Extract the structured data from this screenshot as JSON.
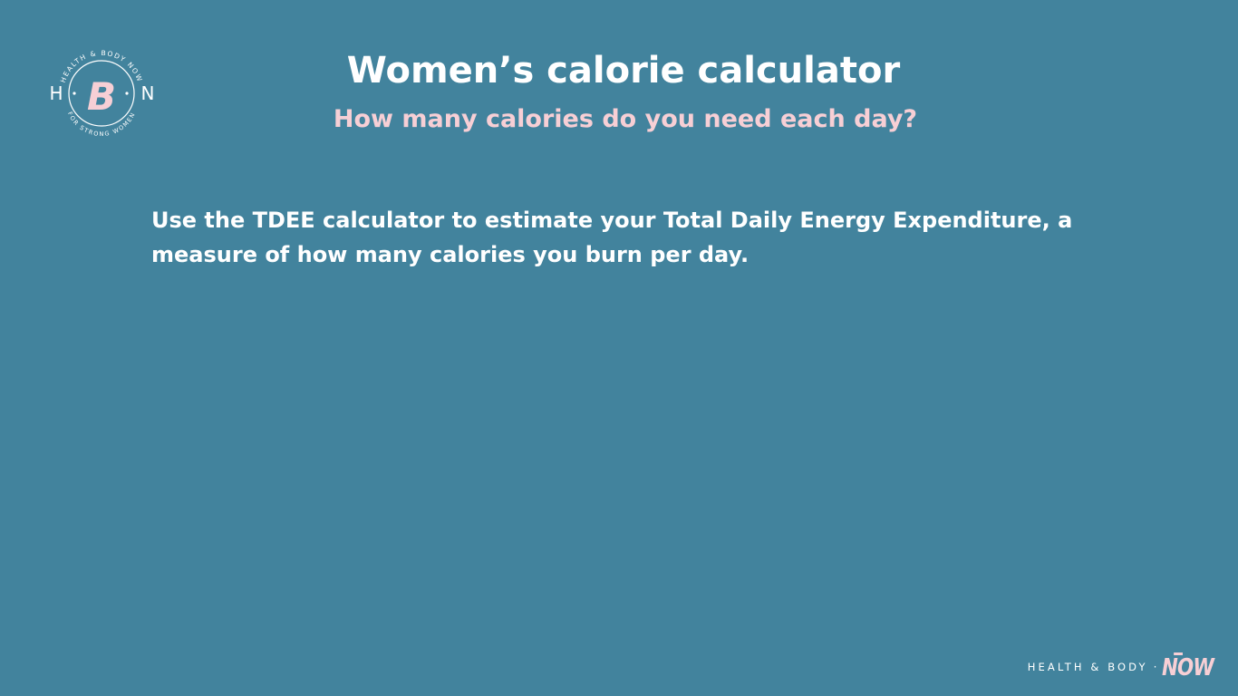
{
  "page": {
    "background_color": "#42839d",
    "accent_color": "#f7cfd5",
    "text_color": "#ffffff"
  },
  "logo": {
    "icon": "hbn-badge-icon",
    "arc_top_text": "HEALTH & BODY NOW",
    "arc_bottom_text": "FOR STRONG WOMEN",
    "left_letter": "H",
    "center_letter": "B",
    "right_letter": "N"
  },
  "header": {
    "title": "Women’s calorie calculator",
    "subtitle": "How many calories do you need each day?"
  },
  "main": {
    "intro": "Use the TDEE calculator to estimate your Total Daily Energy Expenditure, a measure of how many calories you burn per day."
  },
  "footer": {
    "brand_text": "HEALTH & BODY",
    "separator": "·",
    "brand_now": "NOW"
  }
}
